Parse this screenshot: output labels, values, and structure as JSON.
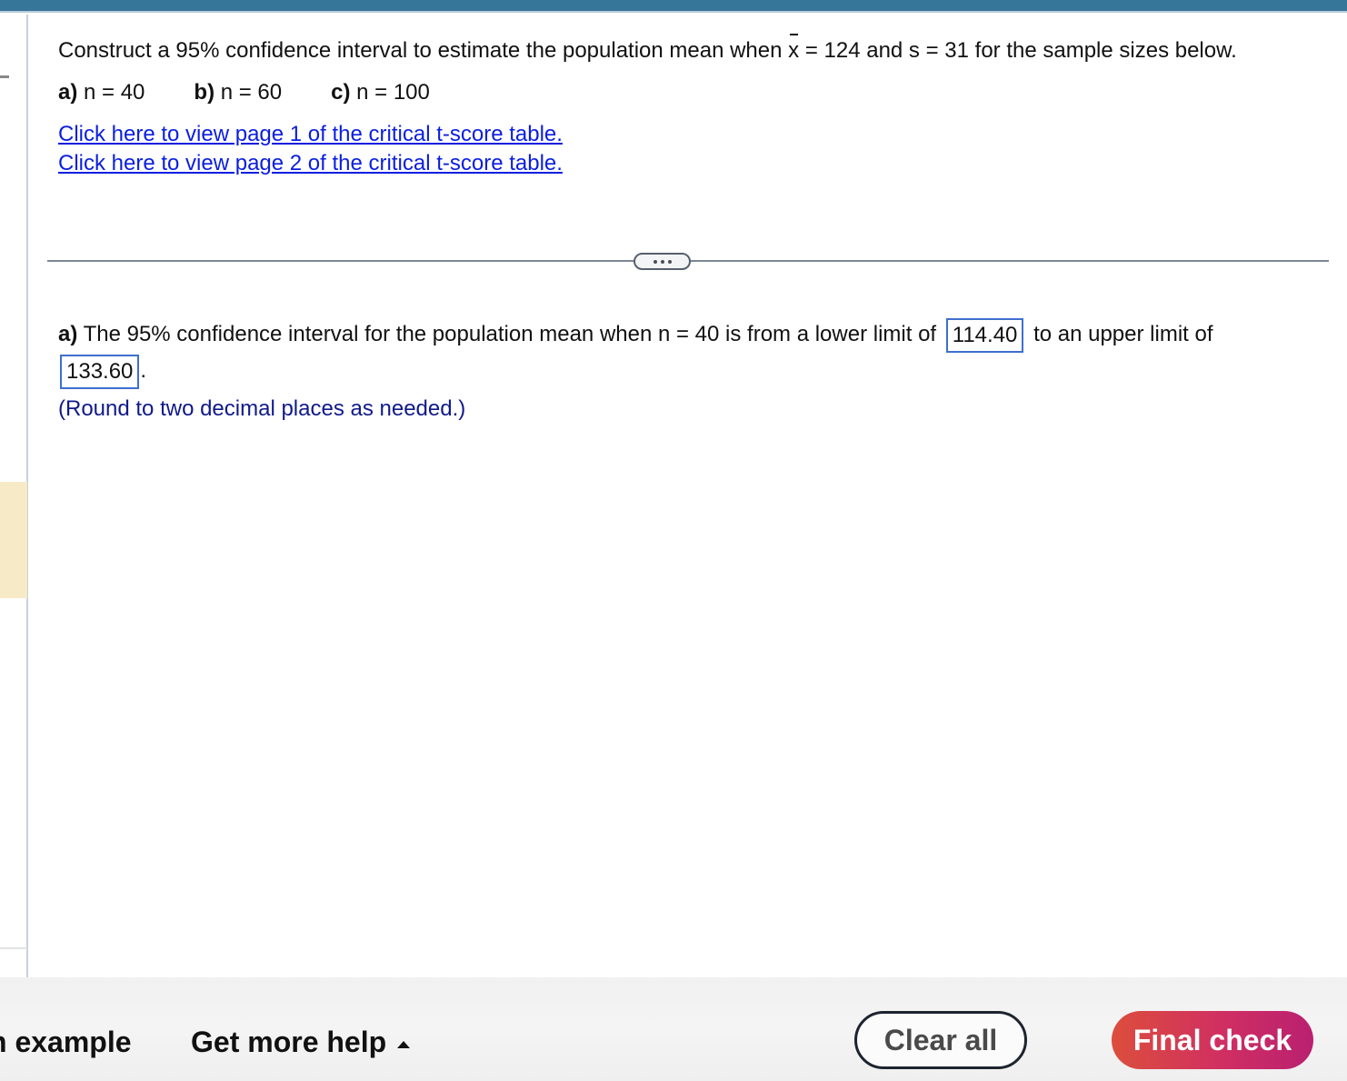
{
  "question": {
    "prefix": "Construct a 95% confidence interval to estimate the population mean when ",
    "xbar_symbol": "x",
    "mid": " = 124 and s = 31 for the sample sizes below.",
    "xbar_value": "124",
    "s_value": "31",
    "parts": [
      {
        "label": "a)",
        "text": " n = 40"
      },
      {
        "label": "b)",
        "text": " n = 60"
      },
      {
        "label": "c)",
        "text": " n = 100"
      }
    ],
    "links": [
      "Click here to view page 1 of the critical t-score table.",
      "Click here to view page 2 of the critical t-score table."
    ]
  },
  "answer": {
    "part_label": "a)",
    "sentence_start": " The 95% confidence interval for the population mean when n = 40 is from a lower limit of",
    "lower_limit": "114.40",
    "sentence_mid": "to an upper limit of",
    "upper_limit": "133.60",
    "sentence_end": ".",
    "hint": "(Round to two decimal places as needed.)"
  },
  "footer": {
    "example_label": "n example",
    "more_help_label": "Get more help",
    "clear_all_label": "Clear all",
    "final_check_label": "Final check"
  },
  "icons": {
    "more": "ellipsis-icon",
    "more_help_caret": "caret-up-icon"
  },
  "colors": {
    "top_bar": "#357699",
    "link": "#0a1ee0",
    "hint": "#101a8a",
    "answer_box_border": "#3f6fcf",
    "final_check_start": "#dc4e3c",
    "final_check_end": "#b92070",
    "highlight": "#f7eac6"
  }
}
